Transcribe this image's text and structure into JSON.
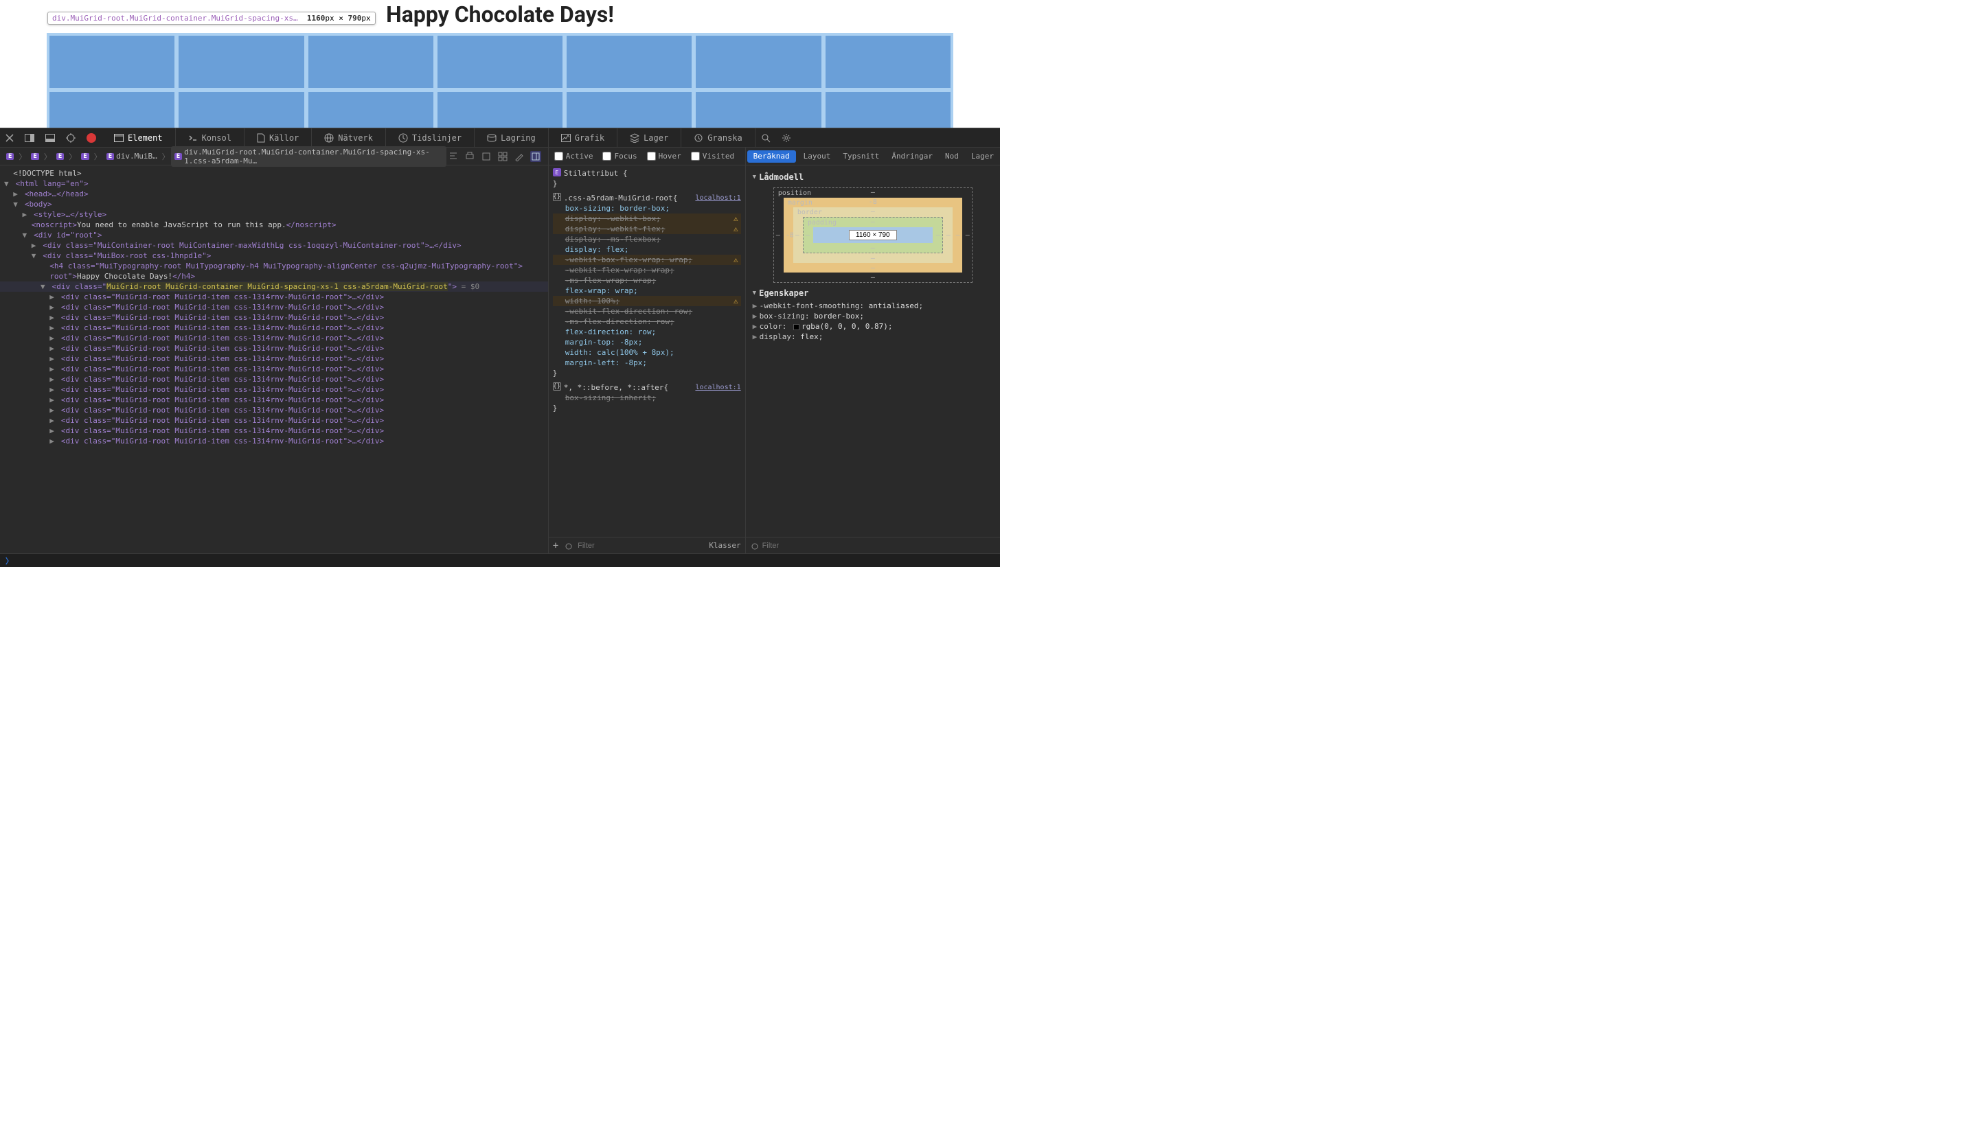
{
  "viewport": {
    "title": "Happy Chocolate Days!",
    "tooltip": {
      "selector": "div.MuiGrid-root.MuiGrid-container.MuiGrid-spacing-xs…",
      "w": "1160",
      "wu": "px",
      "h": "790",
      "hu": "px"
    }
  },
  "tabs": {
    "element": "Element",
    "konsol": "Konsol",
    "kallor": "Källor",
    "natverk": "Nätverk",
    "tidslinjer": "Tidslinjer",
    "lagring": "Lagring",
    "grafik": "Grafik",
    "lager": "Lager",
    "granska": "Granska"
  },
  "crumbs": {
    "c1": "div.MuiB…",
    "c2": "div.MuiGrid-root.MuiGrid-container.MuiGrid-spacing-xs-1.css-a5rdam-Mu…"
  },
  "states": {
    "active": "Active",
    "focus": "Focus",
    "hover": "Hover",
    "visited": "Visited"
  },
  "rtabs": {
    "beraknad": "Beräknad",
    "layout": "Layout",
    "typsnitt": "Typsnitt",
    "andringar": "Ändringar",
    "nod": "Nod",
    "lager": "Lager"
  },
  "dom": {
    "doctype": "<!DOCTYPE html>",
    "html": "<html lang=\"en\">",
    "head": "<head>…</head>",
    "body": "<body>",
    "style": "<style>…</style>",
    "noscript_open": "<noscript>",
    "noscript_text": "You need to enable JavaScript to run this app.",
    "noscript_close": "</noscript>",
    "root": "<div id=\"root\">",
    "container": "<div class=\"MuiContainer-root MuiContainer-maxWidthLg css-1oqqzyl-MuiContainer-root\">…</div>",
    "box": "<div class=\"MuiBox-root css-1hnpd1e\">",
    "h4_open": "<h4 class=\"MuiTypography-root MuiTypography-h4 MuiTypography-alignCenter css-q2ujmz-MuiTypography-root\">",
    "h4_text": "Happy Chocolate Days!",
    "h4_close": "</h4>",
    "grid_pre": "<div class=\"",
    "grid_cls": "MuiGrid-root MuiGrid-container MuiGrid-spacing-xs-1 css-a5rdam-MuiGrid-root",
    "grid_post": "\">",
    "grid_eq": " = $0",
    "item": "<div class=\"MuiGrid-root MuiGrid-item css-13i4rnv-MuiGrid-root\">…</div>"
  },
  "styles": {
    "attr_label": "Stilattribut",
    "src": "localhost:1",
    "sel1": ".css-a5rdam-MuiGrid-root",
    "r1": "box-sizing: border-box;",
    "r2": "display: -webkit-box;",
    "r3": "display: -webkit-flex;",
    "r4": "display: -ms-flexbox;",
    "r5": "display: flex;",
    "r6": "-webkit-box-flex-wrap: wrap;",
    "r7": "-webkit-flex-wrap: wrap;",
    "r8": "-ms-flex-wrap: wrap;",
    "r9": "flex-wrap: wrap;",
    "r10": "width: 100%;",
    "r11": "-webkit-flex-direction: row;",
    "r12": "-ms-flex-direction: row;",
    "r13": "flex-direction: row;",
    "r14": "margin-top: -8px;",
    "r15": "width: calc(100% + 8px);",
    "r16": "margin-left: -8px;",
    "sel2": "*, *::before, *::after",
    "r17": "box-sizing: inherit;"
  },
  "midfoot": {
    "filter": "Filter",
    "klasser": "Klasser"
  },
  "box": {
    "title": "Lådmodell",
    "position": "position",
    "margin": "margin",
    "border": "border",
    "padding": "padding",
    "mt": "-8",
    "mb": "–",
    "ml": "-8",
    "mr": "–",
    "dash": "–",
    "content": "1160 × 790"
  },
  "props": {
    "title": "Egenskaper",
    "p1k": "-webkit-font-smoothing",
    "p1v": "antialiased",
    "p2k": "box-sizing",
    "p2v": "border-box",
    "p3k": "color",
    "p3v": "rgba(0, 0, 0, 0.87)",
    "p4k": "display",
    "p4v": "flex"
  },
  "rfoot": {
    "filter": "Filter"
  }
}
